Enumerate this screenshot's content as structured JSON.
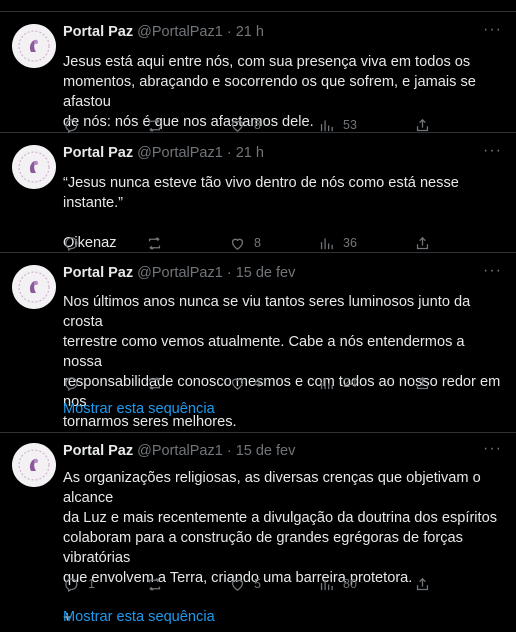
{
  "tweets": [
    {
      "name": "Portal Paz",
      "handle": "@PortalPaz1",
      "dot": "·",
      "time": "21 h",
      "text": "Jesus está aqui entre nós, com sua presença viva em todos os\nmomentos, abraçando e socorrendo os que sofrem, e jamais se afastou\nde nós: nós é que nos afastamos dele.",
      "replies": "",
      "retweets": "",
      "likes": "8",
      "views": "53"
    },
    {
      "name": "Portal Paz",
      "handle": "@PortalPaz1",
      "dot": "·",
      "time": "21 h",
      "text": "“Jesus nunca esteve tão vivo dentro de nós como está nesse instante.”\n\nOikenaz",
      "replies": "",
      "retweets": "",
      "likes": "8",
      "views": "36"
    },
    {
      "name": "Portal Paz",
      "handle": "@PortalPaz1",
      "dot": "·",
      "time": "15 de fev",
      "text": "Nos últimos anos nunca se viu tantos seres luminosos junto da crosta\nterrestre como vemos atualmente. Cabe a nós entendermos a nossa\nresponsabilidade conosco mesmos e com todos ao nosso redor em nos\ntornarmos seres melhores.",
      "replies": "",
      "retweets": "",
      "likes": "4",
      "views": "24",
      "show_thread": "Mostrar esta sequência"
    },
    {
      "name": "Portal Paz",
      "handle": "@PortalPaz1",
      "dot": "·",
      "time": "15 de fev",
      "text": "As organizações religiosas, as diversas crenças que objetivam o alcance\nda Luz e mais recentemente a divulgação da doutrina dos espíritos\ncolaboram para a construção de grandes egrégoras de forças vibratórias\nque envolvem a Terra, criando uma barreira protetora.\n\n+",
      "replies": "1",
      "retweets": "",
      "likes": "5",
      "views": "80",
      "show_thread": "Mostrar esta sequência"
    }
  ],
  "more_icon": "···",
  "colors": {
    "background": "#000000",
    "text": "#e7e9ea",
    "muted": "#71767b",
    "link": "#1d9bf0",
    "border": "#2f3336"
  }
}
